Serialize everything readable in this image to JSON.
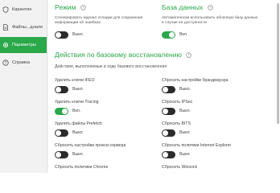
{
  "sidebar": {
    "items": [
      {
        "label": "Карантин",
        "icon": "shield-icon"
      },
      {
        "label": "Файлы...днале",
        "icon": "file-icon"
      },
      {
        "label": "Параметры",
        "icon": "gear-icon",
        "active": true
      },
      {
        "label": "Справка",
        "icon": "help-icon"
      }
    ]
  },
  "mode": {
    "title": "Режим",
    "description": "Сгенерировать журнал отладки для сохранения информации об ошибках",
    "toggle_label": "Выкл.",
    "enabled": false
  },
  "database": {
    "title": "База данных",
    "description": "Автоматически использовать облачную базу данных в случае ее доступности",
    "toggle_label": "Вкл.",
    "enabled": true
  },
  "base_recovery": {
    "title": "Действия по базовому восстановлению",
    "subtitle": "Действия, выполняемые в ходе базового восстановления",
    "left": [
      {
        "label": "Удалить ключи IFEO",
        "state": "Выкл.",
        "enabled": false
      },
      {
        "label": "Удалить ключи Tracing",
        "state": "Вкл.",
        "enabled": true
      },
      {
        "label": "Удалить файлы Prefetch",
        "state": "Выкл.",
        "enabled": false
      },
      {
        "label": "Сбросить настройки прокси-сервера",
        "state": "Выкл.",
        "enabled": false
      },
      {
        "label": "Сбросить политики Chrome",
        "state": "",
        "enabled": false
      }
    ],
    "right": [
      {
        "label": "Сбросить настройки брандмауэра",
        "state": "Выкл.",
        "enabled": false
      },
      {
        "label": "Сбросить IPSec",
        "state": "Выкл.",
        "enabled": false
      },
      {
        "label": "Сбросить BITS",
        "state": "Выкл.",
        "enabled": false
      },
      {
        "label": "Сбросить политики Internet Explorer",
        "state": "Выкл.",
        "enabled": false
      },
      {
        "label": "Сбросить Winsock",
        "state": "",
        "enabled": false
      }
    ]
  },
  "colors": {
    "accent": "#2aa84a",
    "toggle_off": "#2b2b2b"
  }
}
